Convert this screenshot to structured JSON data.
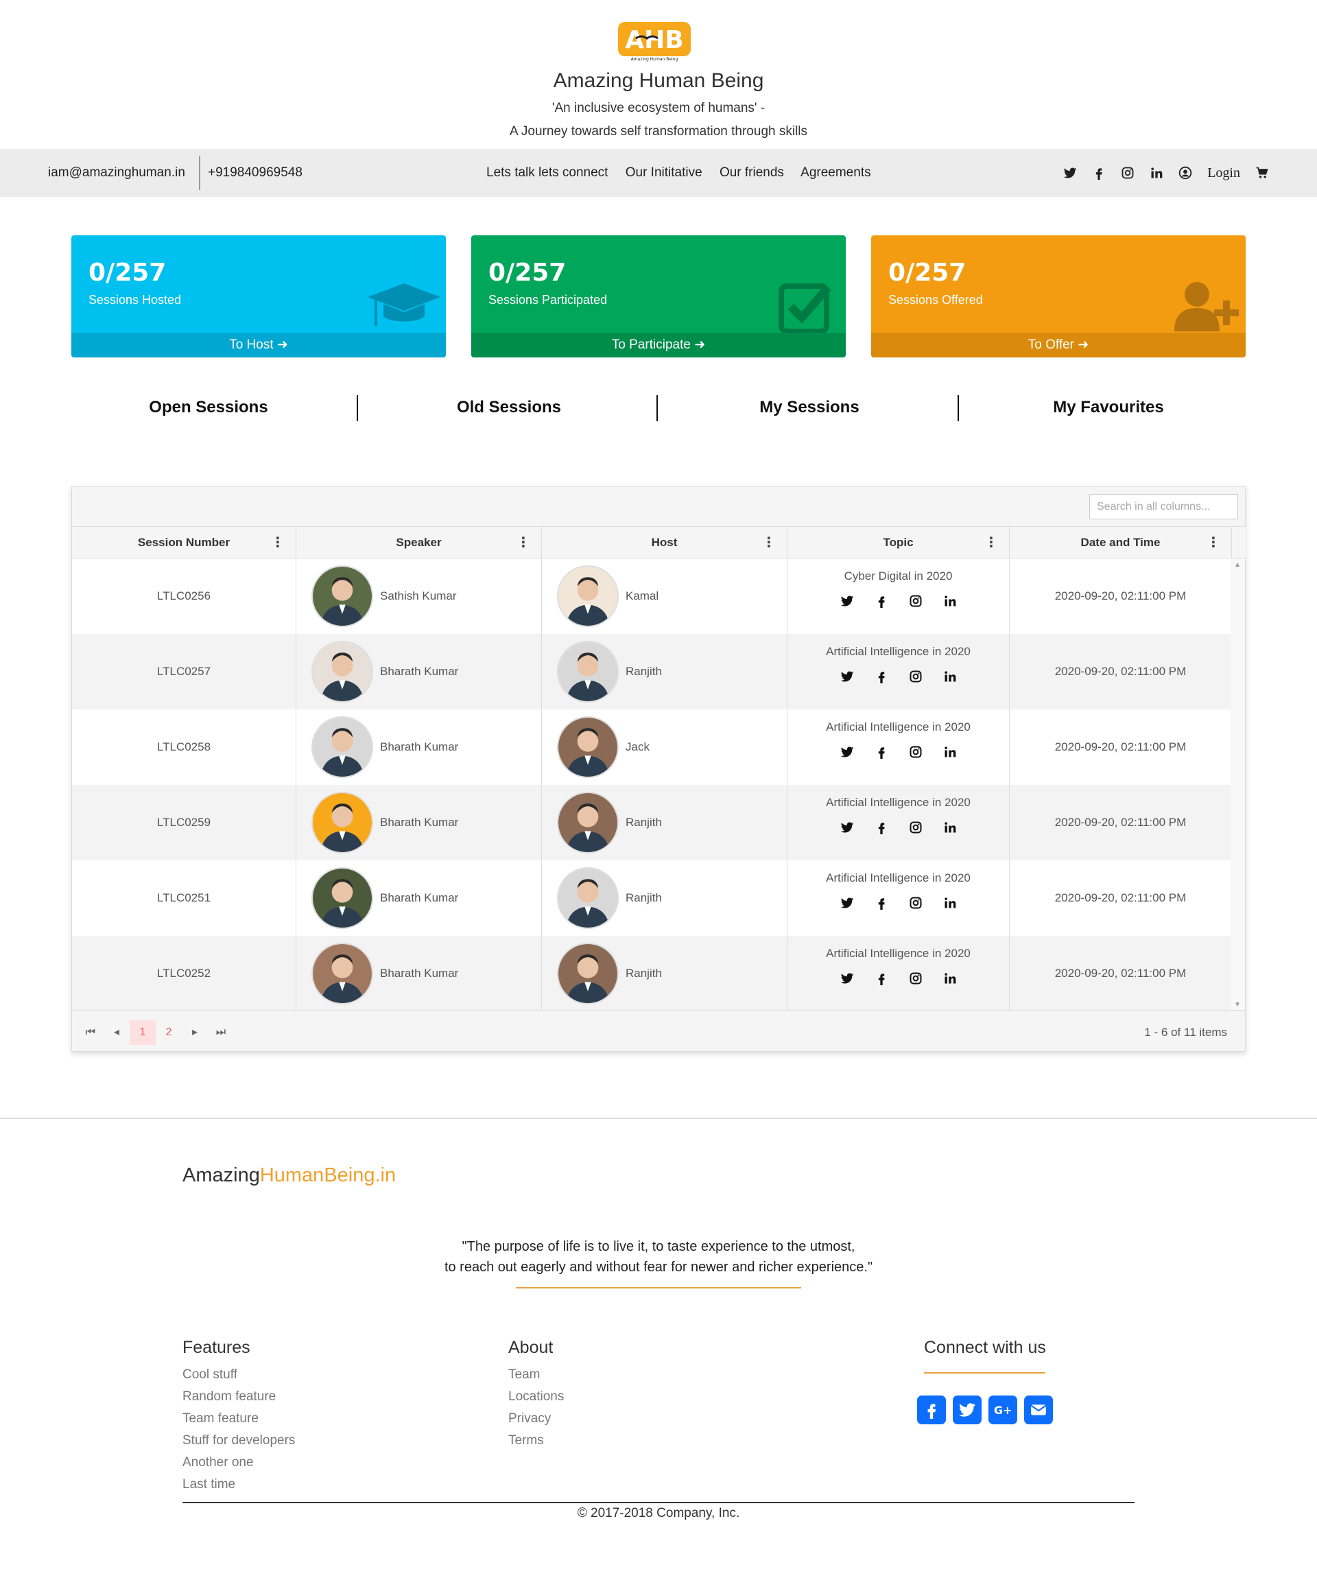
{
  "brand": {
    "name": "Amazing Human Being",
    "tagline1": "'An inclusive ecosystem of humans' -",
    "tagline2": "A Journey towards self transformation through skills",
    "logo_text": "AHB",
    "logo_sub": "Amazing Human Being"
  },
  "navbar": {
    "email": "iam@amazinghuman.in",
    "phone": "+919840969548",
    "links": [
      "Lets talk lets connect",
      "Our Inititative",
      "Our friends",
      "Agreements"
    ],
    "login": "Login"
  },
  "cards": [
    {
      "value": "0/257",
      "label": "Sessions Hosted",
      "action": "To Host",
      "icon": "graduation-cap-icon",
      "color": "#00c0ef"
    },
    {
      "value": "0/257",
      "label": "Sessions Participated",
      "action": "To Participate",
      "icon": "check-square-icon",
      "color": "#00a65a"
    },
    {
      "value": "0/257",
      "label": "Sessions Offered",
      "action": "To Offer",
      "icon": "user-plus-icon",
      "color": "#f39c12"
    }
  ],
  "tabs": [
    "Open Sessions",
    "Old Sessions",
    "My Sessions",
    "My Favourites"
  ],
  "grid": {
    "search_placeholder": "Search in all columns...",
    "columns": [
      "Session Number",
      "Speaker",
      "Host",
      "Topic",
      "Date and Time"
    ],
    "rows": [
      {
        "session": "LTLC0256",
        "speaker": "Sathish Kumar",
        "host": "Kamal",
        "topic": "Cyber Digital in 2020",
        "datetime": "2020-09-20, 02:11:00 PM"
      },
      {
        "session": "LTLC0257",
        "speaker": "Bharath Kumar",
        "host": "Ranjith",
        "topic": "Artificial Intelligence in 2020",
        "datetime": "2020-09-20, 02:11:00 PM"
      },
      {
        "session": "LTLC0258",
        "speaker": "Bharath Kumar",
        "host": "Jack",
        "topic": "Artificial Intelligence in 2020",
        "datetime": "2020-09-20, 02:11:00 PM"
      },
      {
        "session": "LTLC0259",
        "speaker": "Bharath Kumar",
        "host": "Ranjith",
        "topic": "Artificial Intelligence in 2020",
        "datetime": "2020-09-20, 02:11:00 PM"
      },
      {
        "session": "LTLC0251",
        "speaker": "Bharath Kumar",
        "host": "Ranjith",
        "topic": "Artificial Intelligence in 2020",
        "datetime": "2020-09-20, 02:11:00 PM"
      },
      {
        "session": "LTLC0252",
        "speaker": "Bharath Kumar",
        "host": "Ranjith",
        "topic": "Artificial Intelligence in 2020",
        "datetime": "2020-09-20, 02:11:00 PM"
      }
    ],
    "pager": {
      "pages": [
        "1",
        "2"
      ],
      "current": "1",
      "info": "1 - 6 of 11 items"
    }
  },
  "footer": {
    "brand_a": "Amazing",
    "brand_b": "HumanBeing.in",
    "quote1": "\"The purpose of life is to live it, to taste experience to the utmost,",
    "quote2": "to reach out eagerly and without fear for newer and richer experience.\"",
    "features_title": "Features",
    "features": [
      "Cool stuff",
      "Random feature",
      "Team feature",
      "Stuff for developers",
      "Another one",
      "Last time"
    ],
    "about_title": "About",
    "about": [
      "Team",
      "Locations",
      "Privacy",
      "Terms"
    ],
    "connect_title": "Connect with us",
    "copyright": "© 2017-2018 Company, Inc."
  }
}
